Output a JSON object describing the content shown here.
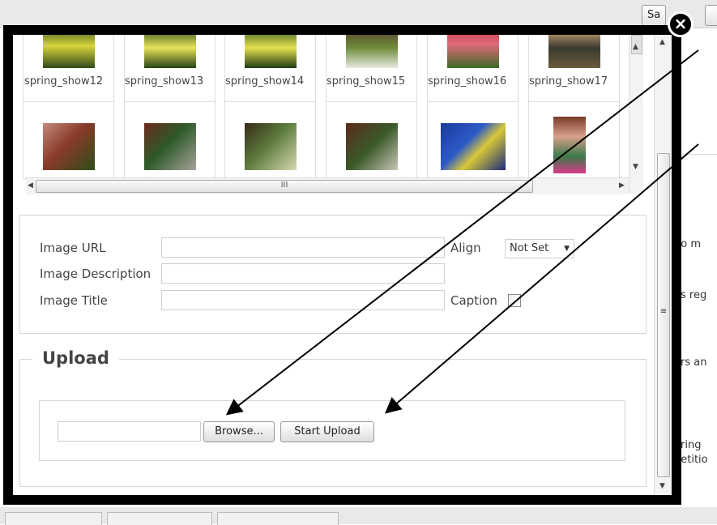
{
  "background": {
    "toolbar_buttons": [
      "Sa",
      ""
    ],
    "right_text": [
      "ho m",
      "es reg",
      "ers an",
      "ering",
      "petitio"
    ]
  },
  "modal": {
    "close_icon": "close-icon"
  },
  "gallery": {
    "captions": [
      "spring_show12",
      "spring_show13",
      "spring_show14",
      "spring_show15",
      "spring_show16",
      "spring_show17"
    ],
    "hscroll_grip": "III",
    "vscroll_grip": "≡"
  },
  "properties": {
    "image_url_label": "Image URL",
    "image_description_label": "Image Description",
    "image_title_label": "Image Title",
    "align_label": "Align",
    "align_value": "Not Set",
    "caption_label": "Caption",
    "image_url_value": "",
    "image_description_value": "",
    "image_title_value": ""
  },
  "upload": {
    "legend": "Upload",
    "file_value": "",
    "browse_label": "Browse...",
    "start_upload_label": "Start Upload"
  }
}
